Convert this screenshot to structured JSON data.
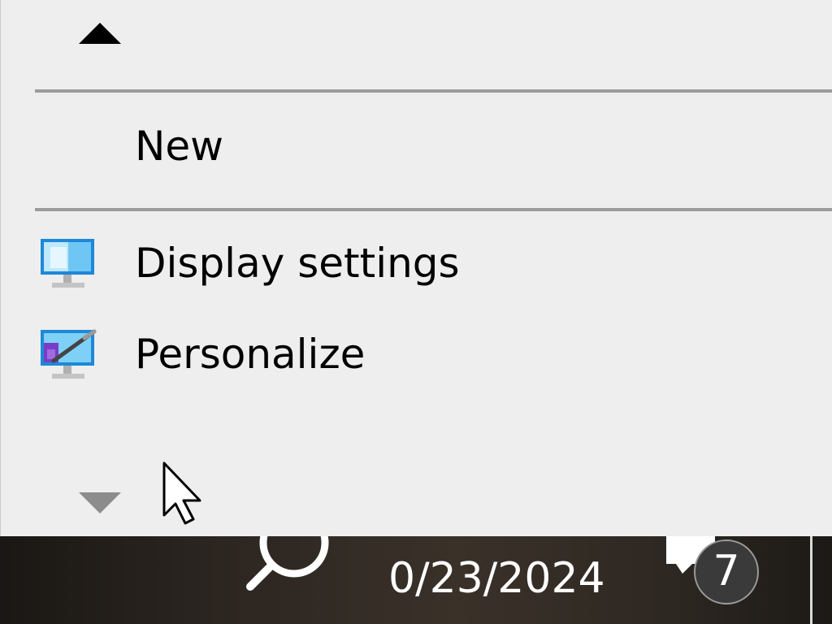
{
  "context_menu": {
    "items": [
      {
        "label": "New",
        "icon": null
      },
      {
        "label": "Display settings",
        "icon": "display-settings-icon"
      },
      {
        "label": "Personalize",
        "icon": "personalize-icon"
      }
    ],
    "scroll_up_icon": "triangle-up-icon",
    "scroll_down_icon": "triangle-down-icon"
  },
  "taskbar": {
    "start_icon": "windows-logo-icon",
    "search_icon": "search-icon",
    "date": "0/23/2024",
    "notifications_icon": "action-center-icon",
    "notification_count": "7"
  },
  "colors": {
    "menu_bg": "#eeeeee",
    "separator": "#9c9c9c",
    "text": "#000000",
    "taskbar_text": "#ffffff"
  }
}
